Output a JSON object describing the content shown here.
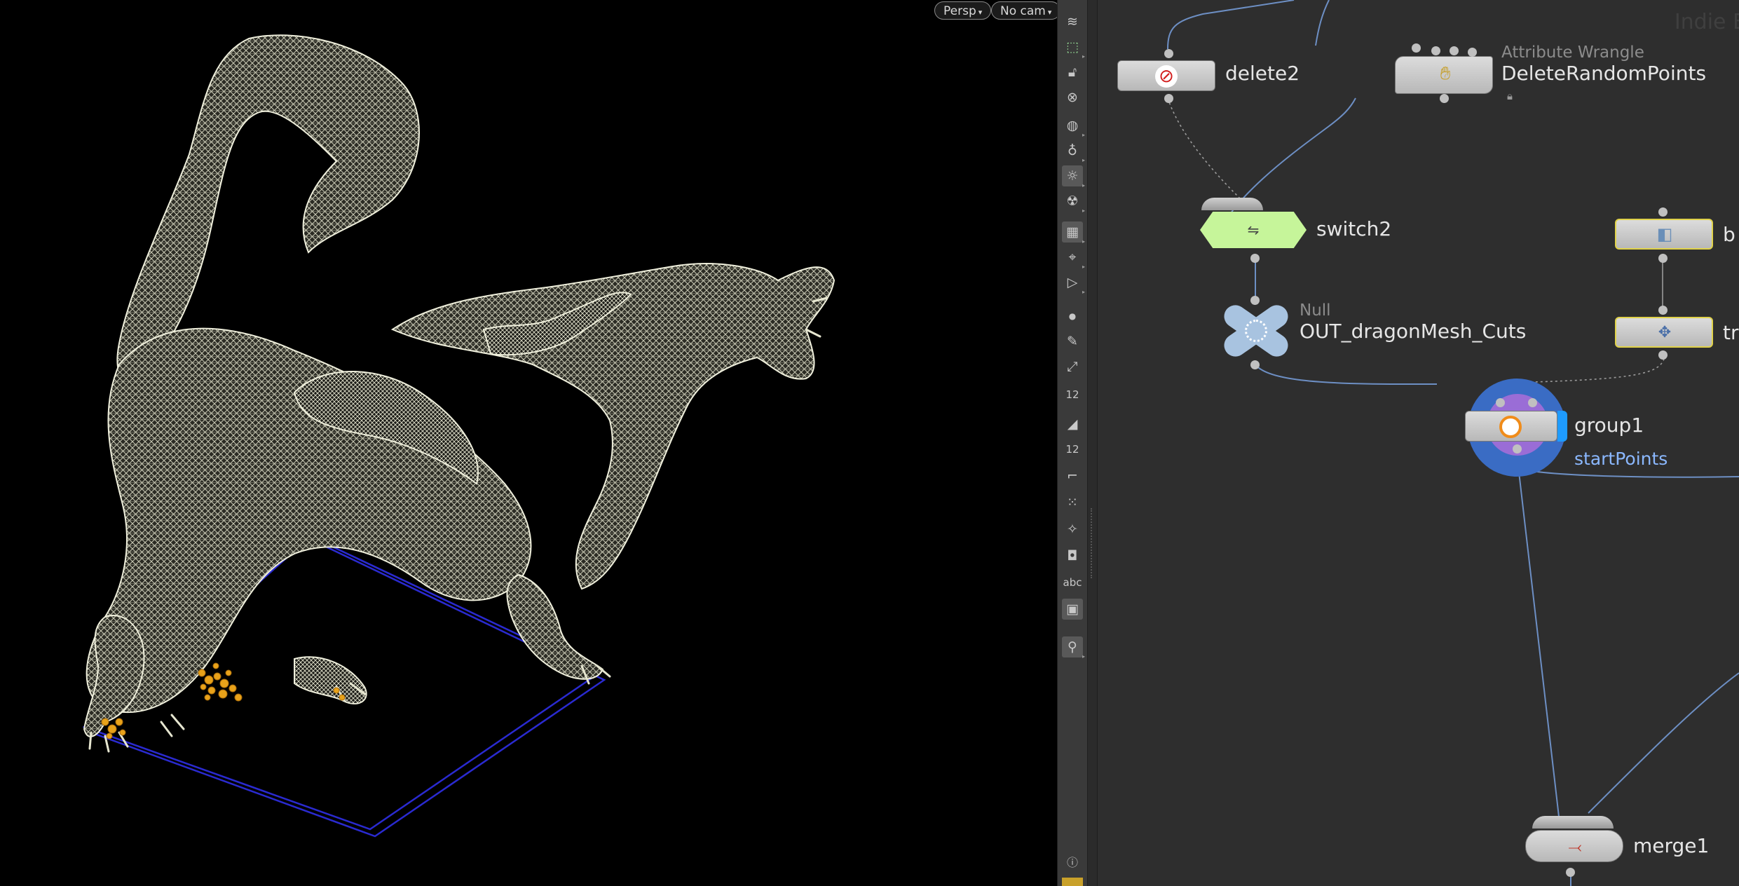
{
  "viewport": {
    "camera_view": "Persp",
    "camera": "No cam"
  },
  "network": {
    "watermark": "Indie E",
    "nodes": {
      "delete2": {
        "label": "delete2",
        "icon": "delete-icon"
      },
      "wrangle": {
        "type": "Attribute Wrangle",
        "label": "DeleteRandomPoints",
        "icon": "wrangle-icon"
      },
      "switch2": {
        "label": "switch2",
        "icon": "switch-icon"
      },
      "null": {
        "type": "Null",
        "label": "OUT_dragonMesh_Cuts",
        "icon": "null-icon"
      },
      "box": {
        "label": "b",
        "icon": "box-icon"
      },
      "transform": {
        "label": "tr",
        "icon": "transform-icon"
      },
      "group1": {
        "label": "group1",
        "flag": "startPoints",
        "icon": "group-icon"
      },
      "merge1": {
        "label": "merge1",
        "icon": "merge-icon"
      }
    }
  },
  "toolbar": {
    "icons": [
      "display-options-icon",
      "geometry-view-icon",
      "lock-icon",
      "close-circle-icon",
      "shading-icon",
      "light-icon",
      "headlight-icon",
      "alien-light-icon",
      "background-icon",
      "guide-icon",
      "render-icon",
      "point-icon",
      "brush-icon",
      "picker-icon",
      "point-numbers-icon",
      "prim-icon",
      "prim-numbers-icon",
      "curve-icon",
      "vertex-icon",
      "normal-icon",
      "box-icon",
      "text-icon",
      "image-icon",
      "pin-icon",
      "info-icon"
    ],
    "numbers_label": "12",
    "prim_numbers_label": "12",
    "text_label": "abc",
    "info_label": "i"
  },
  "colors": {
    "viewport_bg": "#000000",
    "mesh": "#d6d6c0",
    "bbox": "#2a2ad0",
    "selected_points": "#e8a21a",
    "network_bg": "#2e2e2e",
    "wire": "#6d8fc4",
    "switch_node": "#c6f59a",
    "group_ring": "#3a6cc4",
    "group_center": "#9a6dd6",
    "flag_text": "#8bb8ff"
  }
}
